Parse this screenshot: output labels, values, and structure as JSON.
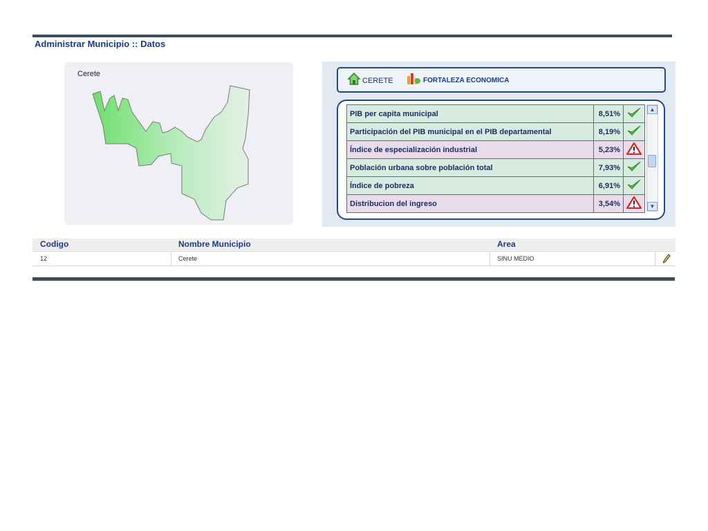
{
  "page": {
    "title": "Administrar Municipio :: Datos"
  },
  "map": {
    "label": "Cerete"
  },
  "indicator_panel": {
    "city": "CERETE",
    "category": "FORTALEZA ECONOMICA",
    "rows": [
      {
        "name": "PIB per capita municipal",
        "value": "8,51%",
        "status": "ok"
      },
      {
        "name": "Participación del PIB municipal en el PIB departamental",
        "value": "8,19%",
        "status": "ok"
      },
      {
        "name": "Índice de especialización industrial",
        "value": "5,23%",
        "status": "warning"
      },
      {
        "name": "Población urbana sobre población total",
        "value": "7,93%",
        "status": "ok"
      },
      {
        "name": "Índice de pobreza",
        "value": "6,91%",
        "status": "ok"
      },
      {
        "name": "Distribucion del ingreso",
        "value": "3,54%",
        "status": "warning"
      }
    ],
    "icons": {
      "ok": "check-icon",
      "warning": "warning-icon"
    }
  },
  "grid": {
    "headers": {
      "codigo": "Codigo",
      "nombre": "Nombre Municipio",
      "area": "Area"
    },
    "rows": [
      {
        "codigo": "12",
        "nombre": "Cerete",
        "area": "SINU MEDIO"
      }
    ]
  },
  "colors": {
    "brand_blue": "#1a3a8a",
    "border_blue": "#1e4a86",
    "ok_row": "#d8ebe0",
    "warn_row": "#e8dbea"
  }
}
